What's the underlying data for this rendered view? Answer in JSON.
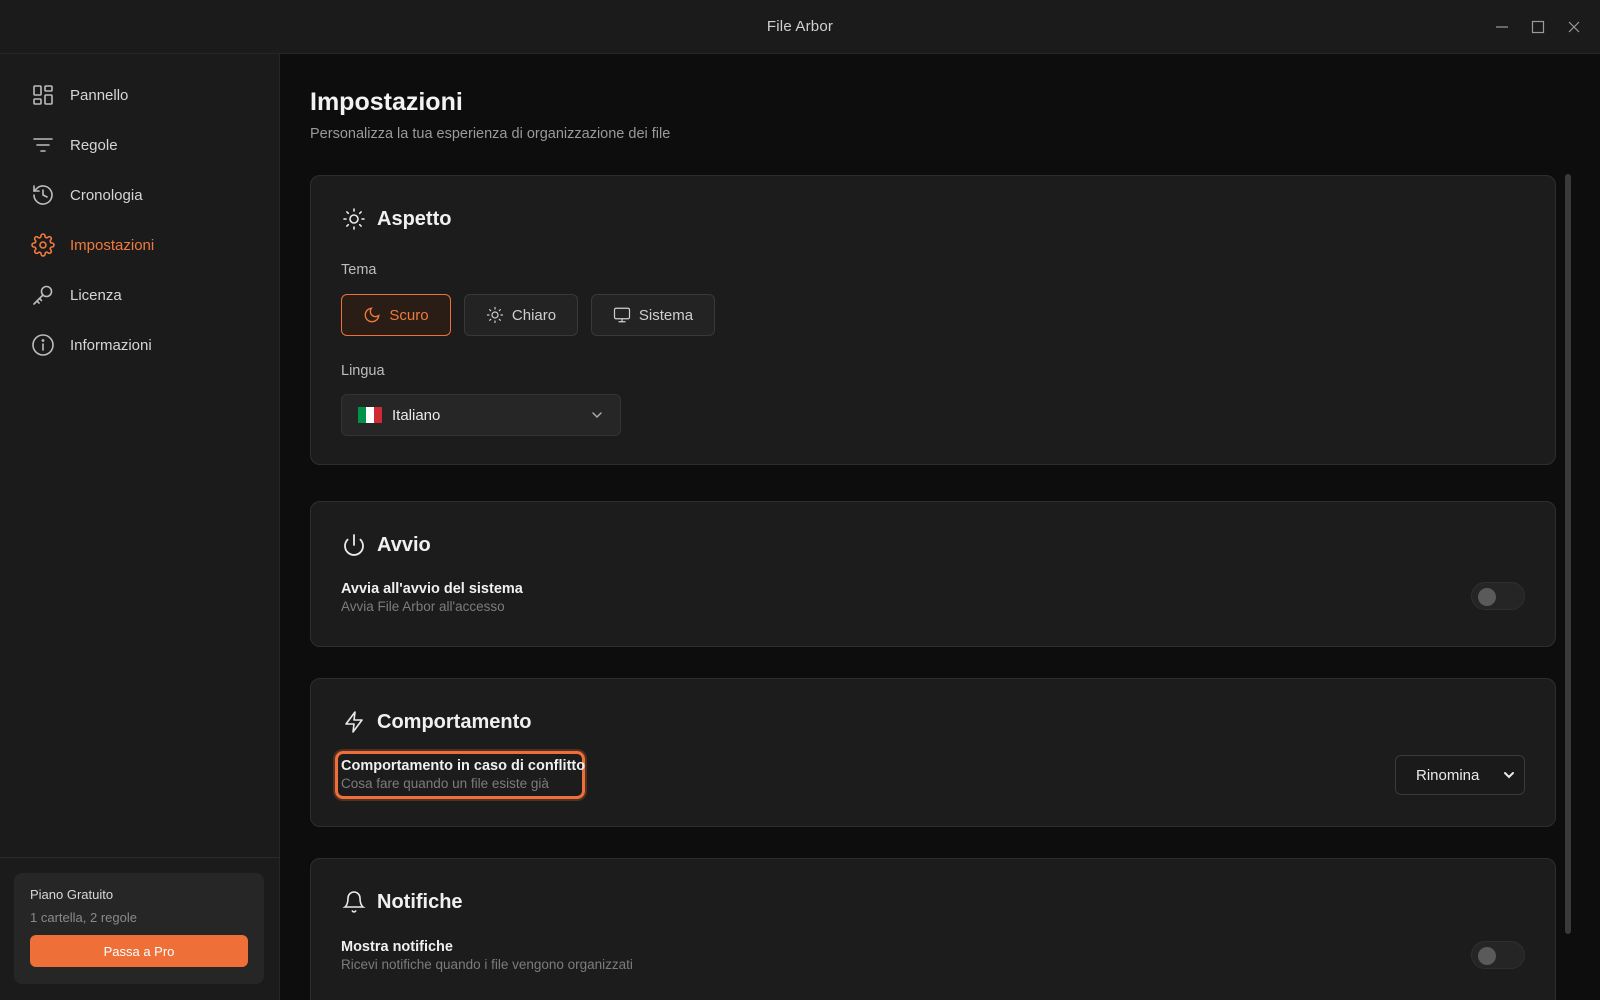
{
  "window": {
    "title": "File Arbor"
  },
  "sidebar": {
    "items": [
      {
        "label": "Pannello",
        "icon": "dashboard-icon"
      },
      {
        "label": "Regole",
        "icon": "filter-icon"
      },
      {
        "label": "Cronologia",
        "icon": "history-icon"
      },
      {
        "label": "Impostazioni",
        "icon": "gear-icon",
        "active": true
      },
      {
        "label": "Licenza",
        "icon": "key-icon"
      },
      {
        "label": "Informazioni",
        "icon": "info-icon"
      }
    ],
    "plan": {
      "title": "Piano Gratuito",
      "subtitle": "1 cartella, 2 regole",
      "upgrade_label": "Passa a Pro"
    }
  },
  "page": {
    "title": "Impostazioni",
    "subtitle": "Personalizza la tua esperienza di organizzazione dei file"
  },
  "appearance": {
    "heading": "Aspetto",
    "theme_label": "Tema",
    "themes": [
      {
        "label": "Scuro",
        "icon": "moon-icon",
        "selected": true
      },
      {
        "label": "Chiaro",
        "icon": "sun-icon",
        "selected": false
      },
      {
        "label": "Sistema",
        "icon": "monitor-icon",
        "selected": false
      }
    ],
    "language_label": "Lingua",
    "language_value": "Italiano",
    "flag_colors": [
      "#009246",
      "#ffffff",
      "#ce2b37"
    ]
  },
  "startup": {
    "heading": "Avvio",
    "launch_title": "Avvia all'avvio del sistema",
    "launch_desc": "Avvia File Arbor all'accesso",
    "launch_enabled": false
  },
  "behavior": {
    "heading": "Comportamento",
    "conflict_title": "Comportamento in caso di conflitto",
    "conflict_desc": "Cosa fare quando un file esiste già",
    "conflict_value": "Rinomina"
  },
  "notifications": {
    "heading": "Notifiche",
    "show_title": "Mostra notifiche",
    "show_desc": "Ricevi notifiche quando i file vengono organizzati",
    "show_enabled": false
  },
  "colors": {
    "accent": "#ee7038",
    "background": "#0d0d0d",
    "panel": "#1c1c1c"
  }
}
